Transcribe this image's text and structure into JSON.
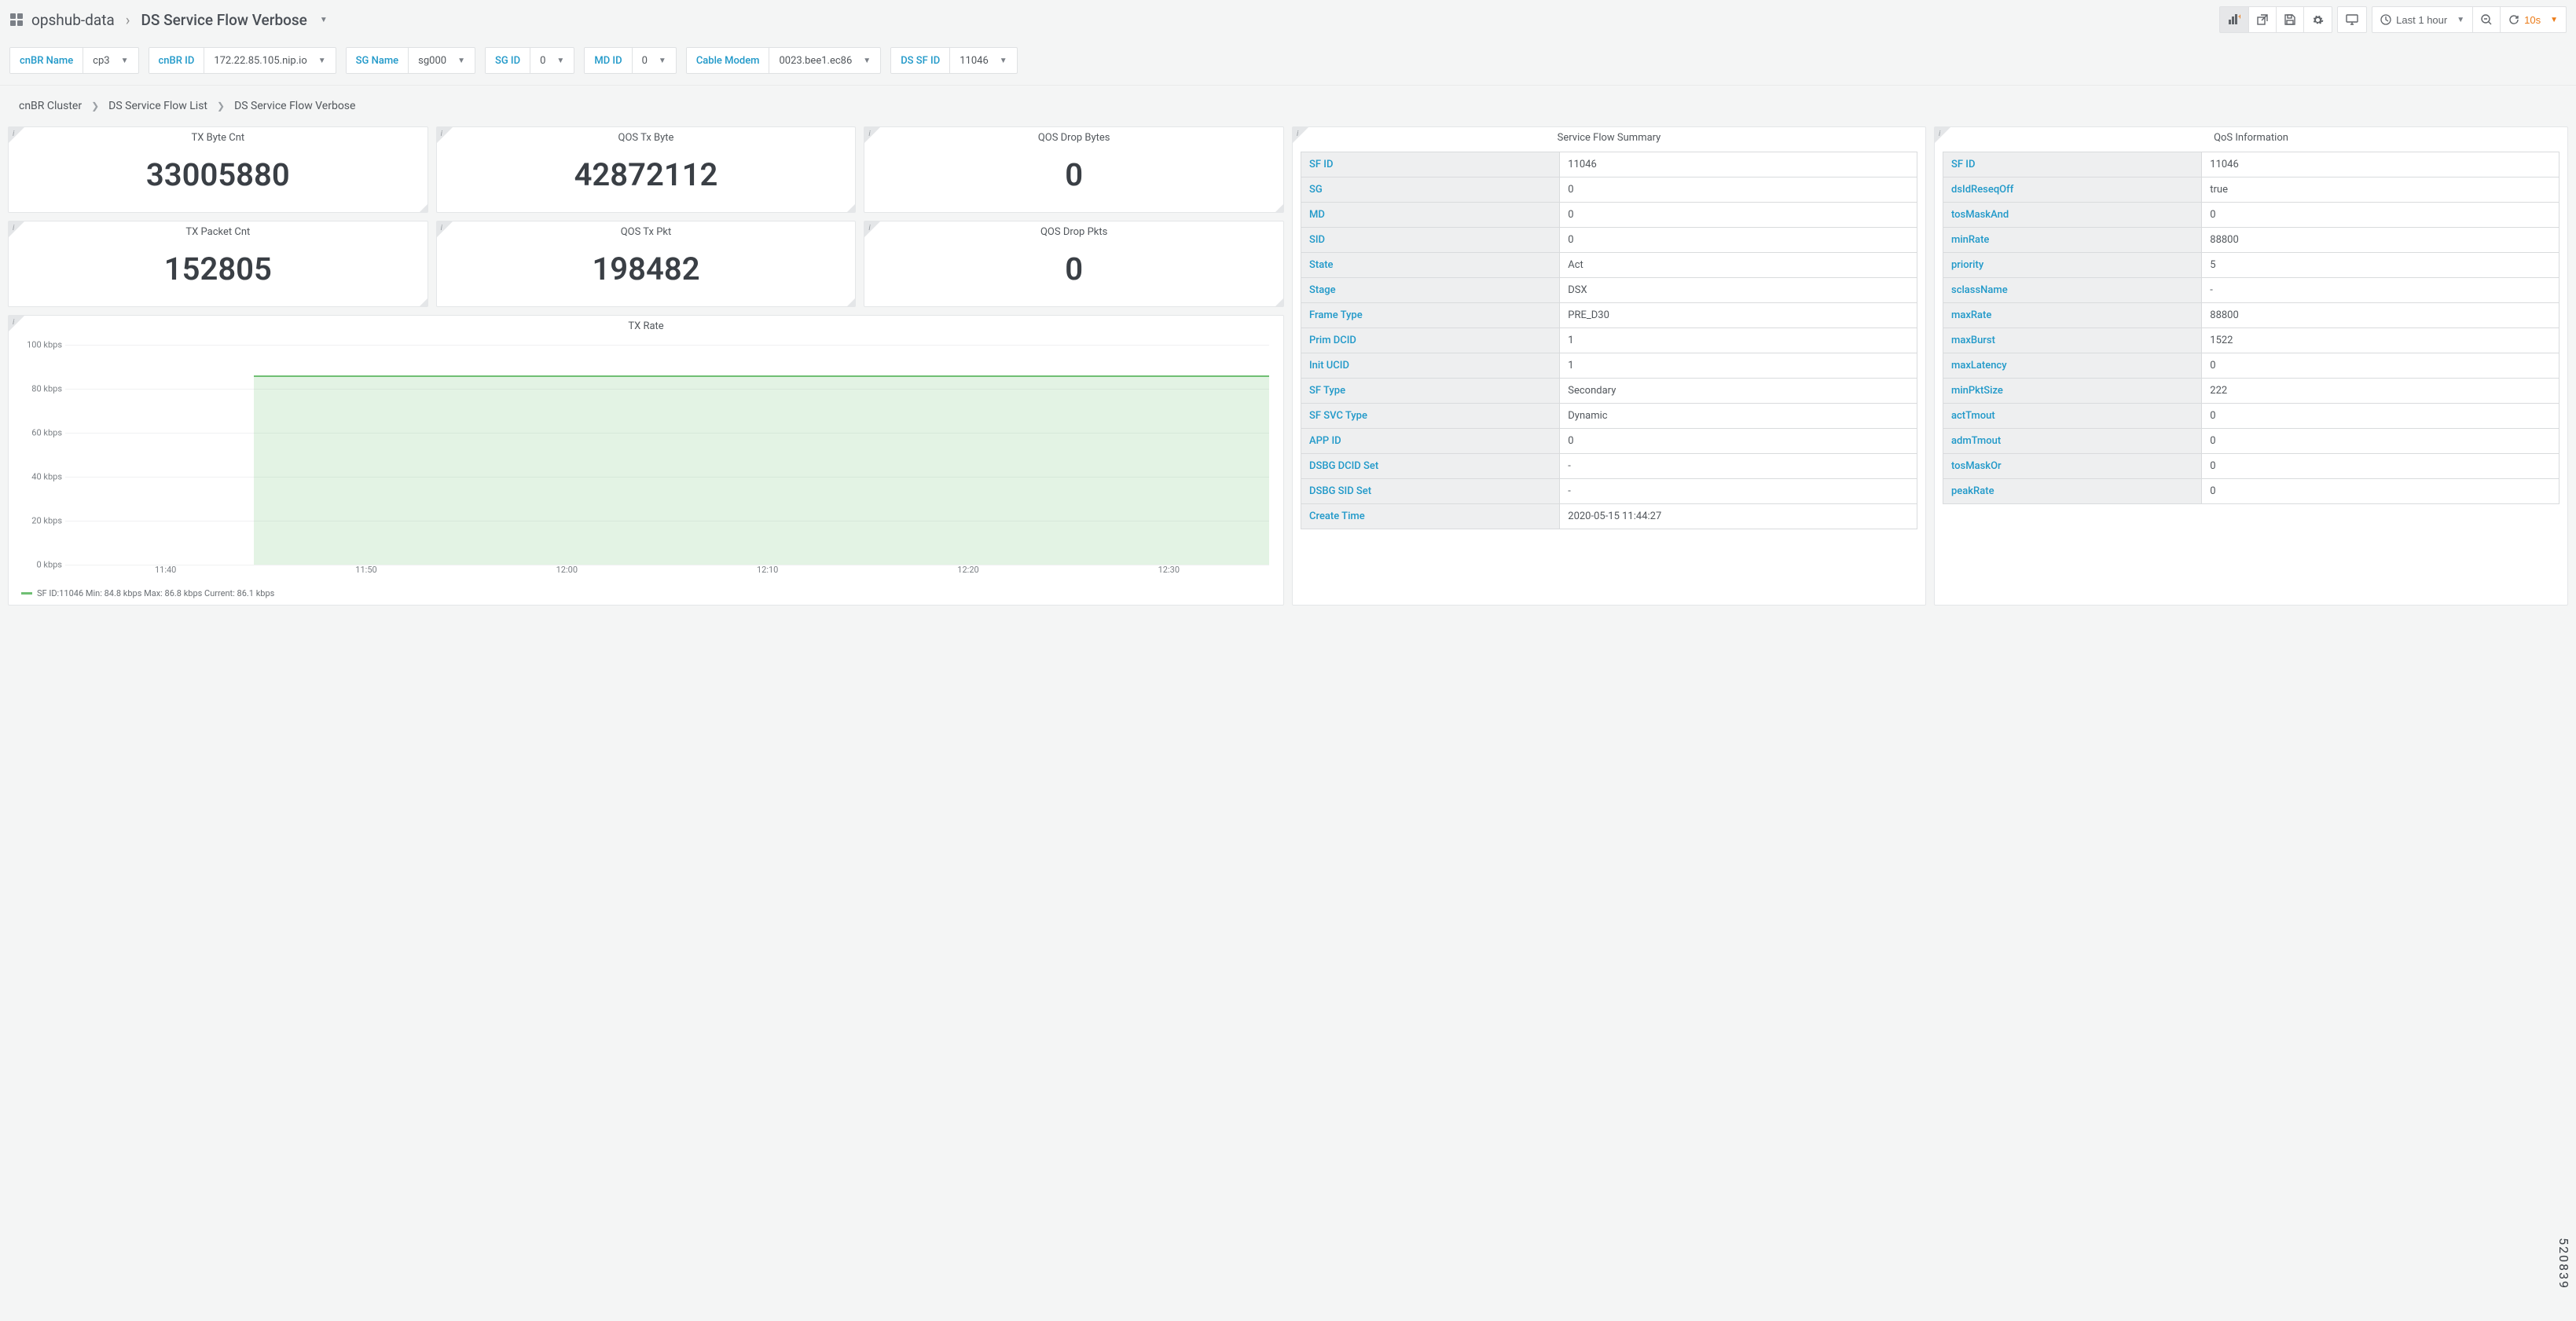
{
  "header": {
    "folder": "opshub-data",
    "title": "DS Service Flow Verbose"
  },
  "toolbar": {
    "time_range": "Last 1 hour",
    "refresh_interval": "10s"
  },
  "vars": [
    {
      "label": "cnBR Name",
      "value": "cp3"
    },
    {
      "label": "cnBR ID",
      "value": "172.22.85.105.nip.io"
    },
    {
      "label": "SG Name",
      "value": "sg000"
    },
    {
      "label": "SG ID",
      "value": "0"
    },
    {
      "label": "MD ID",
      "value": "0"
    },
    {
      "label": "Cable Modem",
      "value": "0023.bee1.ec86"
    },
    {
      "label": "DS SF ID",
      "value": "11046"
    }
  ],
  "inner_breadcrumb": {
    "a": "cnBR Cluster",
    "b": "DS Service Flow List",
    "c": "DS Service Flow Verbose"
  },
  "stats": {
    "tx_byte_cnt": {
      "title": "TX Byte Cnt",
      "value": "33005880"
    },
    "qos_tx_byte": {
      "title": "QOS Tx Byte",
      "value": "42872112"
    },
    "qos_drop_bytes": {
      "title": "QOS Drop Bytes",
      "value": "0"
    },
    "tx_packet_cnt": {
      "title": "TX Packet Cnt",
      "value": "152805"
    },
    "qos_tx_pkt": {
      "title": "QOS Tx Pkt",
      "value": "198482"
    },
    "qos_drop_pkts": {
      "title": "QOS Drop Pkts",
      "value": "0"
    }
  },
  "summary": {
    "title": "Service Flow Summary",
    "rows": [
      {
        "k": "SF ID",
        "v": "11046"
      },
      {
        "k": "SG",
        "v": "0"
      },
      {
        "k": "MD",
        "v": "0"
      },
      {
        "k": "SID",
        "v": "0"
      },
      {
        "k": "State",
        "v": "Act"
      },
      {
        "k": "Stage",
        "v": "DSX"
      },
      {
        "k": "Frame Type",
        "v": "PRE_D30"
      },
      {
        "k": "Prim DCID",
        "v": "1"
      },
      {
        "k": "Init UCID",
        "v": "1"
      },
      {
        "k": "SF Type",
        "v": "Secondary"
      },
      {
        "k": "SF SVC Type",
        "v": "Dynamic"
      },
      {
        "k": "APP ID",
        "v": "0"
      },
      {
        "k": "DSBG DCID Set",
        "v": "-"
      },
      {
        "k": "DSBG SID Set",
        "v": "-"
      },
      {
        "k": "Create Time",
        "v": "2020-05-15 11:44:27"
      }
    ]
  },
  "qos": {
    "title": "QoS Information",
    "rows": [
      {
        "k": "SF ID",
        "v": "11046"
      },
      {
        "k": "dsIdReseqOff",
        "v": "true"
      },
      {
        "k": "tosMaskAnd",
        "v": "0"
      },
      {
        "k": "minRate",
        "v": "88800"
      },
      {
        "k": "priority",
        "v": "5"
      },
      {
        "k": "sclassName",
        "v": "-"
      },
      {
        "k": "maxRate",
        "v": "88800"
      },
      {
        "k": "maxBurst",
        "v": "1522"
      },
      {
        "k": "maxLatency",
        "v": "0"
      },
      {
        "k": "minPktSize",
        "v": "222"
      },
      {
        "k": "actTmout",
        "v": "0"
      },
      {
        "k": "admTmout",
        "v": "0"
      },
      {
        "k": "tosMaskOr",
        "v": "0"
      },
      {
        "k": "peakRate",
        "v": "0"
      }
    ]
  },
  "chart": {
    "title": "TX Rate",
    "legend": "SF ID:11046   Min: 84.8 kbps  Max: 86.8 kbps  Current: 86.1 kbps"
  },
  "chart_data": {
    "type": "area",
    "title": "TX Rate",
    "xlabel": "",
    "ylabel": "",
    "y_unit": "kbps",
    "ylim": [
      0,
      100
    ],
    "y_ticks": [
      0,
      20,
      40,
      60,
      80,
      100
    ],
    "x_ticks": [
      "11:40",
      "11:50",
      "12:00",
      "12:10",
      "12:20",
      "12:30"
    ],
    "x_range_minutes": [
      -5,
      55
    ],
    "series": [
      {
        "name": "SF ID:11046",
        "color": "#6fbf73",
        "min": 84.8,
        "max": 86.8,
        "current": 86.1,
        "note": "data begins ~11:44; zero before",
        "x_minutes": [
          -5,
          4.4,
          4.4,
          5,
          10,
          15,
          20,
          25,
          30,
          35,
          40,
          45,
          50,
          55
        ],
        "values": [
          0,
          0,
          85.5,
          85.7,
          86.0,
          85.8,
          86.2,
          85.9,
          86.4,
          85.6,
          86.1,
          85.8,
          86.3,
          86.1
        ]
      }
    ]
  },
  "side_id": "520839"
}
